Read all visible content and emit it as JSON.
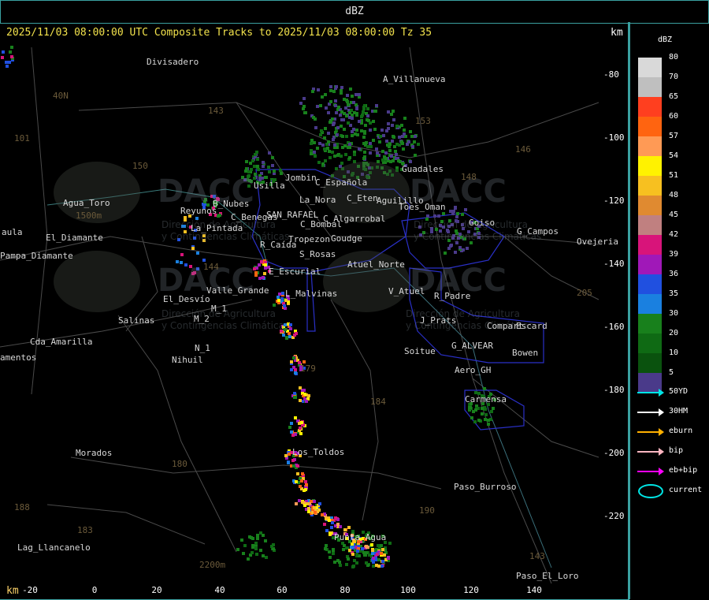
{
  "window": {
    "title": "dBZ"
  },
  "header": {
    "text": "2025/11/03 08:00:00 UTC Composite Tracks to 2025/11/03 08:00:00 Tz 35",
    "unit_top": "km",
    "unit_bottom": "km"
  },
  "axes": {
    "y_ticks": [
      "-80",
      "-100",
      "-120",
      "-140",
      "-160",
      "-180",
      "-200",
      "-220"
    ],
    "x_ticks": [
      "-20",
      "0",
      "20",
      "40",
      "60",
      "80",
      "100",
      "120",
      "140"
    ]
  },
  "legend": {
    "title": "dBZ",
    "levels": [
      {
        "label": "80",
        "color": "#d9d9d9"
      },
      {
        "label": "70",
        "color": "#bfbfbf"
      },
      {
        "label": "65",
        "color": "#ff3f1f"
      },
      {
        "label": "60",
        "color": "#ff6410"
      },
      {
        "label": "57",
        "color": "#ff9a55"
      },
      {
        "label": "54",
        "color": "#fff200"
      },
      {
        "label": "51",
        "color": "#f7c020"
      },
      {
        "label": "48",
        "color": "#e08a30"
      },
      {
        "label": "45",
        "color": "#c08080"
      },
      {
        "label": "42",
        "color": "#d8147a"
      },
      {
        "label": "39",
        "color": "#a018b8"
      },
      {
        "label": "36",
        "color": "#2050e0"
      },
      {
        "label": "35",
        "color": "#1a80e0"
      },
      {
        "label": "30",
        "color": "#18801c"
      },
      {
        "label": "20",
        "color": "#0f6a14"
      },
      {
        "label": "10",
        "color": "#0a520e"
      },
      {
        "label": "5",
        "color": "#4a3a8a"
      }
    ],
    "tracks": [
      {
        "label": "50YD",
        "color": "#00e5e5"
      },
      {
        "label": "30HM",
        "color": "#ffffff"
      },
      {
        "label": "eburn",
        "color": "#ffb000"
      },
      {
        "label": "bip",
        "color": "#ffb6c1"
      },
      {
        "label": "eb+bip",
        "color": "#ff00ff"
      },
      {
        "label": "current",
        "color": "#00e5e5"
      }
    ]
  },
  "places": [
    {
      "name": "Divisadero"
    },
    {
      "name": "A_Villanueva"
    },
    {
      "name": "40N"
    },
    {
      "name": "101"
    },
    {
      "name": "143"
    },
    {
      "name": "153"
    },
    {
      "name": "146"
    },
    {
      "name": "Guadales"
    },
    {
      "name": "148"
    },
    {
      "name": "Jombin"
    },
    {
      "name": "Usilla"
    },
    {
      "name": "C_Española"
    },
    {
      "name": "C_Eten"
    },
    {
      "name": "Aguilillo"
    },
    {
      "name": "150"
    },
    {
      "name": "Agua_Toro"
    },
    {
      "name": "1500m"
    },
    {
      "name": "Reyunos"
    },
    {
      "name": "B_Nubes"
    },
    {
      "name": "C_Benegas"
    },
    {
      "name": "SAN_RAFAEL"
    },
    {
      "name": "La_Nora"
    },
    {
      "name": "C_Algarrobal"
    },
    {
      "name": "Toes_Oman"
    },
    {
      "name": "Goiso"
    },
    {
      "name": "G_Campos"
    },
    {
      "name": "Ovejeria"
    },
    {
      "name": "aula"
    },
    {
      "name": "La_Pintada"
    },
    {
      "name": "C_Bombal"
    },
    {
      "name": "El_Diamante"
    },
    {
      "name": "Tropezon"
    },
    {
      "name": "Goudge"
    },
    {
      "name": "Pampa_Diamante"
    },
    {
      "name": "R_Caída"
    },
    {
      "name": "S_Rosas"
    },
    {
      "name": "Atuel_Norte"
    },
    {
      "name": "E_Escurial"
    },
    {
      "name": "144"
    },
    {
      "name": "Valle_Grande"
    },
    {
      "name": "L_Malvinas"
    },
    {
      "name": "V_Atuel"
    },
    {
      "name": "R_Padre"
    },
    {
      "name": "El_Desvío"
    },
    {
      "name": "205"
    },
    {
      "name": "Salinas"
    },
    {
      "name": "M_2"
    },
    {
      "name": "M_1"
    },
    {
      "name": "J_Prats"
    },
    {
      "name": "Compart"
    },
    {
      "name": "Escard"
    },
    {
      "name": "Cda_Amarilla"
    },
    {
      "name": "G_ALVEAR"
    },
    {
      "name": "Bowen"
    },
    {
      "name": "amentos"
    },
    {
      "name": "N_1"
    },
    {
      "name": "Nihuil"
    },
    {
      "name": "Soitue"
    },
    {
      "name": "179"
    },
    {
      "name": "Aero_GH"
    },
    {
      "name": "184"
    },
    {
      "name": "Carmensa"
    },
    {
      "name": "Los_Toldos"
    },
    {
      "name": "Morados"
    },
    {
      "name": "180"
    },
    {
      "name": "Paso_Burroso"
    },
    {
      "name": "190"
    },
    {
      "name": "Lag_Llancanelo"
    },
    {
      "name": "183"
    },
    {
      "name": "Punta_Agua"
    },
    {
      "name": "2200m"
    },
    {
      "name": "143"
    },
    {
      "name": "Paso_El_Loro"
    },
    {
      "name": "188"
    }
  ],
  "watermark": {
    "brand": "DACC",
    "sub1": "Dirección de Agricultura",
    "sub2": "y Contingencias Climáticas"
  }
}
